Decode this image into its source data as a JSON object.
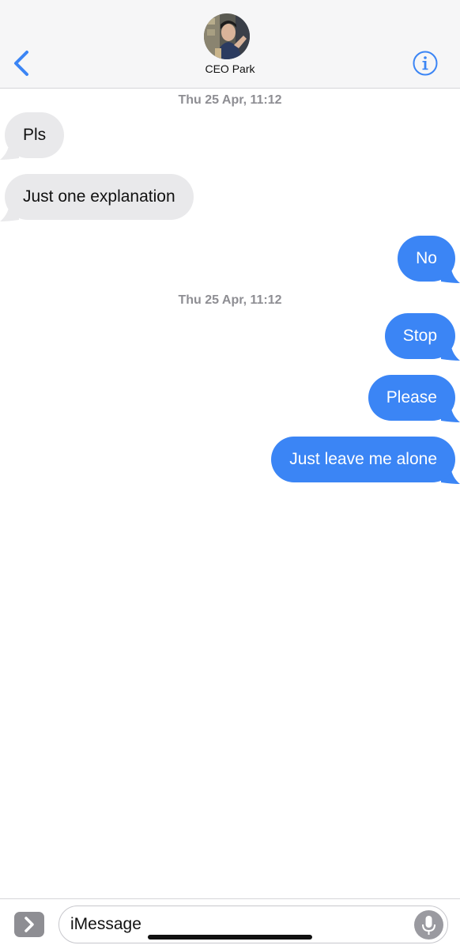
{
  "header": {
    "contact_name": "CEO Park",
    "back_icon": "chevron-left-icon",
    "info_icon": "info-circle-icon",
    "accent_color": "#3b85f5"
  },
  "conversation": {
    "timestamps": [
      "Thu 25 Apr, 11:12",
      "Thu 25 Apr, 11:12"
    ],
    "messages": [
      {
        "sender": "contact",
        "text": "Pls"
      },
      {
        "sender": "contact",
        "text": "Just one explanation"
      },
      {
        "sender": "me",
        "text": "No"
      },
      {
        "sender": "me",
        "text": "Stop"
      },
      {
        "sender": "me",
        "text": "Please"
      },
      {
        "sender": "me",
        "text": "Just leave me alone"
      }
    ],
    "incoming_color": "#e9e9eb",
    "outgoing_color": "#3b85f5"
  },
  "composer": {
    "placeholder": "iMessage",
    "apps_icon": "chevron-right-icon",
    "mic_icon": "microphone-icon"
  }
}
